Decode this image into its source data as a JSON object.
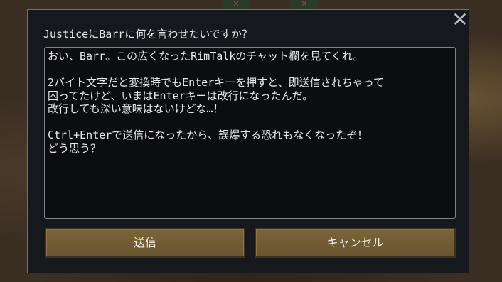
{
  "dialog": {
    "prompt": "JusticeにBarrに何を言わせたいですか？",
    "message": "おい、Barr。この広くなったRimTalkのチャット欄を見てくれ。\n\n2バイト文字だと変換時でもEnterキーを押すと、即送信されちゃって\n困ってたけど、いまはEnterキーは改行になったんだ。\n改行しても深い意味はないけどな…！\n\nCtrl+Enterで送信になったから、誤爆する恐れもなくなったぞ！\nどう思う？",
    "close_icon": "✕",
    "send_label": "送信",
    "cancel_label": "キャンセル"
  },
  "colors": {
    "panel_bg": "#15191e",
    "button_bg": "#7a6439",
    "text": "#e8e8e8"
  }
}
